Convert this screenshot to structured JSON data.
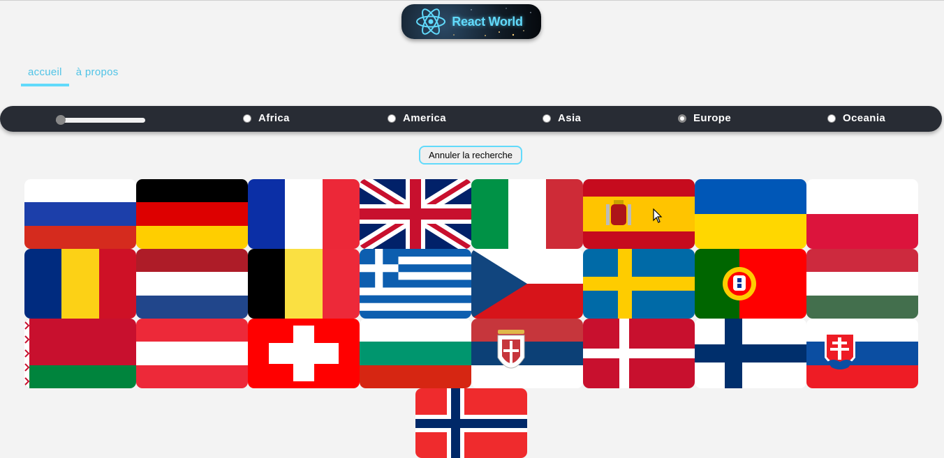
{
  "header": {
    "logo_text": "React World",
    "logo_icon": "react-atom-icon"
  },
  "nav": {
    "items": [
      {
        "label": "accueil",
        "active": true
      },
      {
        "label": "à propos",
        "active": false
      }
    ]
  },
  "filters": {
    "regions": [
      {
        "label": "Africa",
        "checked": false
      },
      {
        "label": "America",
        "checked": false
      },
      {
        "label": "Asia",
        "checked": false
      },
      {
        "label": "Europe",
        "checked": true
      },
      {
        "label": "Oceania",
        "checked": false
      }
    ],
    "range_value": 0
  },
  "cancel_label": "Annuler la recherche",
  "colors": {
    "accent": "#61dafb",
    "bar_bg": "#282c34",
    "page_bg": "#f3f3f3"
  },
  "flags": [
    "russia-flag",
    "germany-flag",
    "france-flag",
    "united-kingdom-flag",
    "italy-flag",
    "spain-flag",
    "ukraine-flag",
    "poland-flag",
    "romania-flag",
    "netherlands-flag",
    "belgium-flag",
    "greece-flag",
    "czechia-flag",
    "sweden-flag",
    "portugal-flag",
    "hungary-flag",
    "belarus-flag",
    "austria-flag",
    "switzerland-flag",
    "bulgaria-flag",
    "serbia-flag",
    "denmark-flag",
    "finland-flag",
    "slovakia-flag",
    "norway-flag"
  ]
}
